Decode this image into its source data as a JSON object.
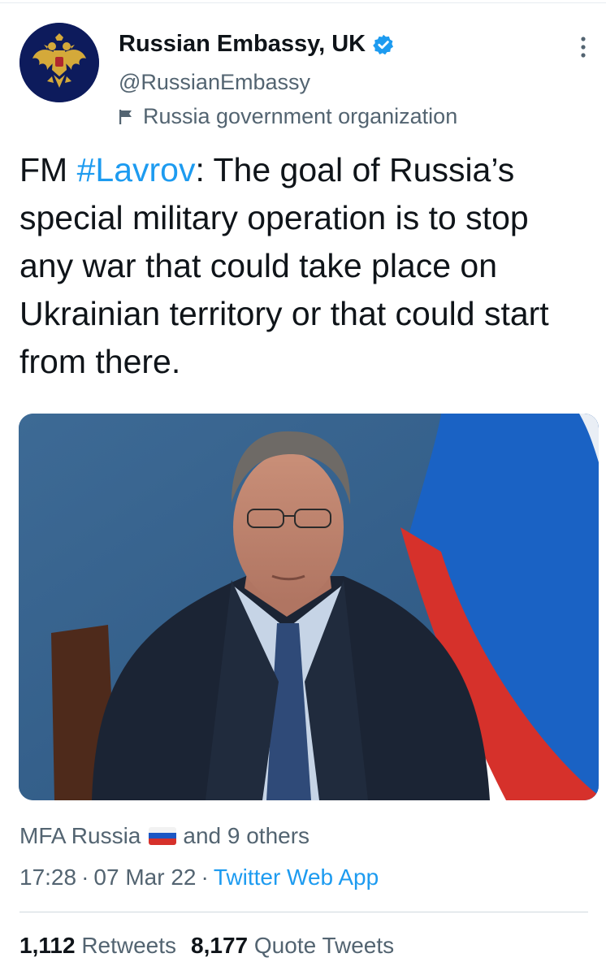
{
  "account": {
    "display_name": "Russian Embassy, UK",
    "handle": "@RussianEmbassy",
    "label": "Russia government organization"
  },
  "tweet": {
    "text_prefix": "FM ",
    "hashtag": "#Lavrov",
    "text_rest": ": The goal of Russia’s special military operation is to stop any war that could take place on Ukrainian territory or that could start from there."
  },
  "engagement": {
    "liked_by_name": "MFA Russia",
    "liked_by_rest": "and 9 others"
  },
  "meta": {
    "time": "17:28",
    "separator": "·",
    "date": "07 Mar 22",
    "source": "Twitter Web App"
  },
  "stats": {
    "retweets_count": "1,112",
    "retweets_label": "Retweets",
    "quotes_count": "8,177",
    "quotes_label": "Quote Tweets"
  },
  "colors": {
    "link_blue": "#1d9bf0",
    "secondary_text": "#536471",
    "primary_text": "#0f1419",
    "avatar_bg": "#0d1b5c"
  },
  "icons": {
    "verified": "verified-badge-icon",
    "label_flag": "flag-icon",
    "more": "more-options-icon"
  }
}
